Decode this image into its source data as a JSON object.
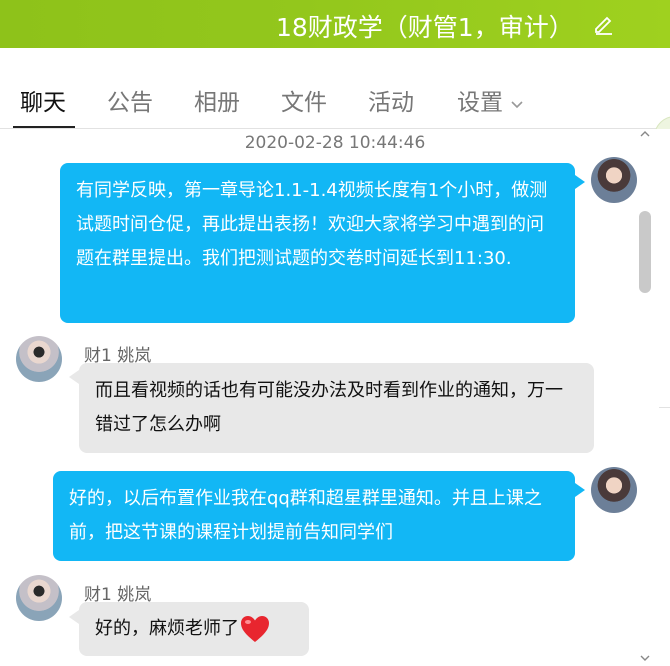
{
  "header": {
    "title": "18财政学（财管1，审计）",
    "edit_icon": "edit-pencil-icon"
  },
  "tabs": [
    {
      "label": "聊天",
      "active": true
    },
    {
      "label": "公告"
    },
    {
      "label": "相册"
    },
    {
      "label": "文件"
    },
    {
      "label": "活动"
    },
    {
      "label": "设置",
      "icon": "chevron-down-icon"
    }
  ],
  "chat": {
    "timestamp": "2020-02-28 10:44:46",
    "messages": [
      {
        "side": "right",
        "text": "有同学反映，第一章导论1.1-1.4视频长度有1个小时，做测试题时间仓促，再此提出表扬！欢迎大家将学习中遇到的问题在群里提出。我们把测试题的交卷时间延长到11:30."
      },
      {
        "side": "left",
        "sender": "财1 姚岚",
        "text": "而且看视频的话也有可能没办法及时看到作业的通知，万一错过了怎么办啊"
      },
      {
        "side": "right",
        "text": "好的，以后布置作业我在qq群和超星群里通知。并且上课之前，把这节课的课程计划提前告知同学们"
      },
      {
        "side": "left",
        "sender": "财1 姚岚",
        "text": "好的，麻烦老师了",
        "emoji": "heart-icon"
      }
    ]
  },
  "colors": {
    "header_green": "#93c71c",
    "bubble_blue": "#12b7f5",
    "bubble_gray": "#e8e8e8"
  }
}
